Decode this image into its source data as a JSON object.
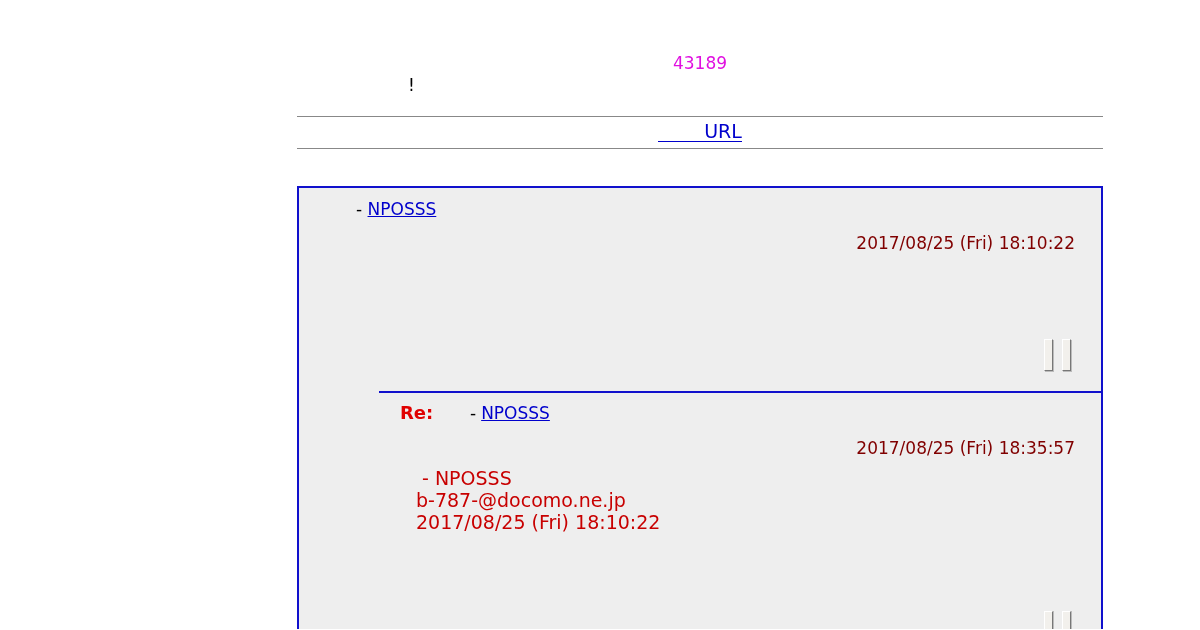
{
  "header": {
    "counter": "43189",
    "notice": "!"
  },
  "nav": {
    "link": "URL"
  },
  "thread": {
    "post": {
      "separator": "-",
      "author": "NPOSSS",
      "date": "2017/08/25 (Fri) 18:10:22",
      "buttons": [
        {
          "kind": "blank"
        },
        {
          "kind": "blank"
        }
      ]
    },
    "replies": [
      {
        "prefix": "Re:",
        "separator": "-",
        "author": "NPOSSS",
        "date": "2017/08/25 (Fri) 18:35:57",
        "quote": [
          "- NPOSSS",
          "b-787-@docomo.ne.jp",
          "2017/08/25 (Fri) 18:10:22"
        ],
        "buttons": [
          {
            "kind": "blank"
          },
          {
            "kind": "blank"
          }
        ]
      }
    ]
  }
}
